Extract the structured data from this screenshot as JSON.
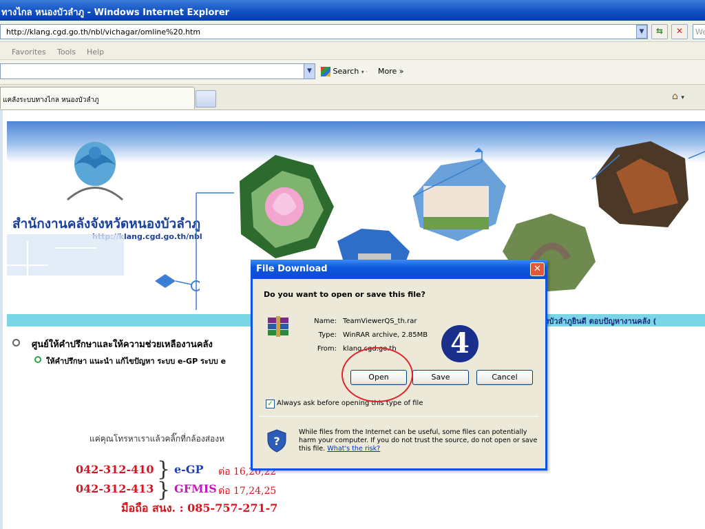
{
  "window": {
    "title": "ทางไกล หนองบัวลำภู - Windows Internet Explorer"
  },
  "address": {
    "url": "http://klang.cgd.go.th/nbl/vichagar/omline%20.htm",
    "search_placeholder": "We"
  },
  "menu": {
    "items": [
      "Favorites",
      "Tools",
      "Help"
    ]
  },
  "toolbar": {
    "search_label": "Search",
    "more_label": "More »"
  },
  "tabs": {
    "active_label": "แคลังระบบทางไกล หนองบัวลำภู"
  },
  "page": {
    "office_name": "สำนักงานคลังจังหวัดหนองบัวลำภู",
    "site_url": "http://klang.cgd.go.th/nbl",
    "marquee": "งบัวลำภูยินดี ตอบปัญหางานคลัง (",
    "consult_title": "ศูนย์ให้คำปรึกษาและให้ความช่วยเหลืองานคลัง",
    "consult_desc": "ให้คำปรึกษา แนะนำ แก้ไขปัญหา ระบบ e-GP ระบบ e",
    "call_text": "แค่คุณโทรหาเราแล้วคลิ๊กที่กล้องส่องห",
    "phone1": "042-312-410",
    "phone1_system": "e-GP",
    "phone1_ext": "ต่อ 16,20,22",
    "phone2": "042-312-413",
    "phone2_system": "GFMIS",
    "phone2_ext": "ต่อ 17,24,25",
    "mobile": "มือถือ สนง. : 085-757-271-7"
  },
  "dialog": {
    "title": "File Download",
    "question": "Do you want to open or save this file?",
    "name_label": "Name:",
    "name_value": "TeamViewerQS_th.rar",
    "type_label": "Type:",
    "type_value": "WinRAR archive, 2.85MB",
    "from_label": "From:",
    "from_value": "klang.cgd.go.th",
    "open_label": "Open",
    "save_label": "Save",
    "cancel_label": "Cancel",
    "always_ask_label": "Always ask before opening this type of file",
    "warning": "While files from the Internet can be useful, some files can potentially harm your computer. If you do not trust the source, do not open or save this file.",
    "risk_link": "What's the risk?"
  },
  "annotation": {
    "step": "4"
  },
  "colors": {
    "title_blue": "#0a4cd0",
    "phone_red": "#d4141e",
    "egp_blue": "#1c3fb8",
    "gfmis_magenta": "#c418b8",
    "ring_red": "#e0232a"
  }
}
